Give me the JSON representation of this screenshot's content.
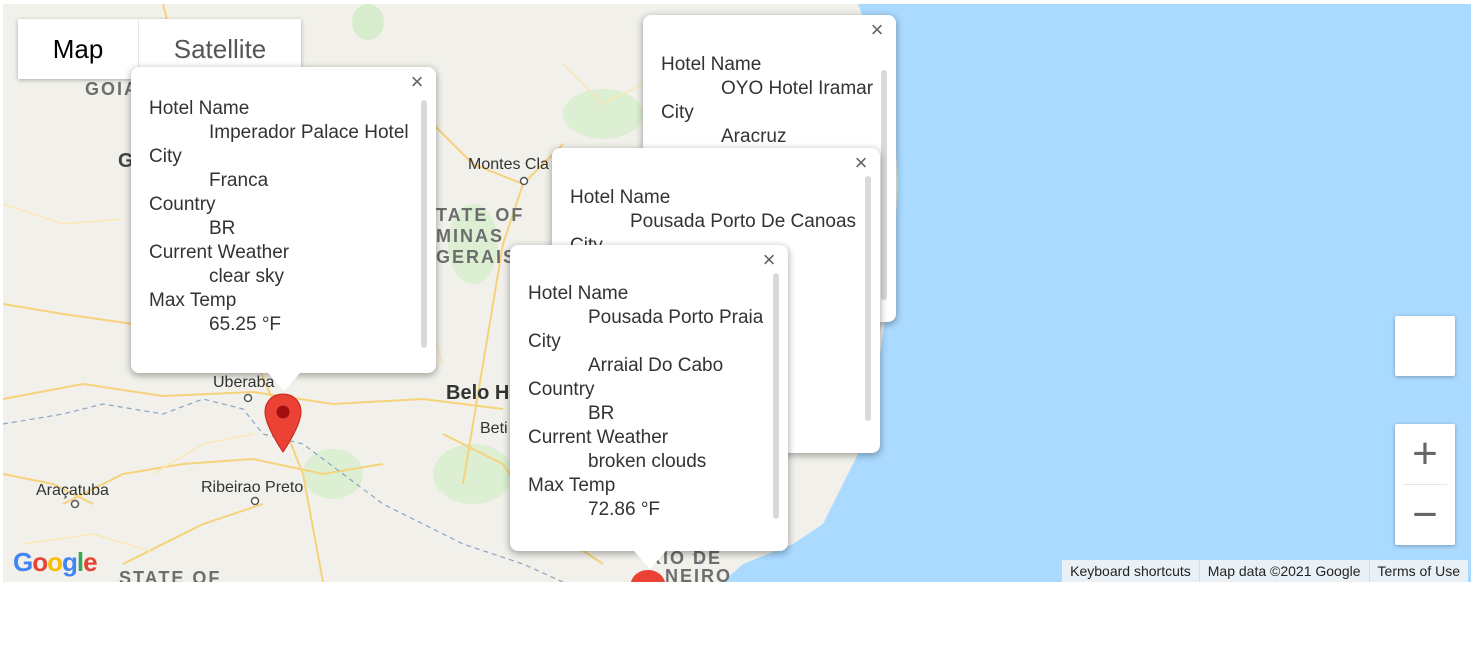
{
  "map_type": {
    "map_label": "Map",
    "satellite_label": "Satellite",
    "selected": "Map"
  },
  "place_labels": [
    {
      "id": "goias",
      "text": "GOIA"
    },
    {
      "id": "g",
      "text": "G"
    },
    {
      "id": "montes-claros",
      "text": "Montes Cla"
    },
    {
      "id": "state-of",
      "text": "TATE OF"
    },
    {
      "id": "minas",
      "text": "MINAS"
    },
    {
      "id": "gerais",
      "text": "GERAIS"
    },
    {
      "id": "uberaba",
      "text": "Uberaba"
    },
    {
      "id": "belo-horizonte",
      "text": "Belo H"
    },
    {
      "id": "betim",
      "text": "Beti"
    },
    {
      "id": "aracatuba",
      "text": "Araçatuba"
    },
    {
      "id": "ribeirao-preto",
      "text": "Ribeirao Preto"
    },
    {
      "id": "state-of-bottom",
      "text": "STATE OF"
    },
    {
      "id": "rio-de",
      "text": "RIO DE"
    },
    {
      "id": "janeiro",
      "text": "NEIRO"
    }
  ],
  "info_windows": [
    {
      "hotel_name_label": "Hotel Name",
      "hotel_name": "OYO Hotel Iramar",
      "city_label": "City",
      "city": "Aracruz"
    },
    {
      "hotel_name_label": "Hotel Name",
      "hotel_name": "Pousada Porto De Canoas",
      "city_label": "City"
    },
    {
      "hotel_name_label": "Hotel Name",
      "hotel_name": "Imperador Palace Hotel",
      "city_label": "City",
      "city": "Franca",
      "country_label": "Country",
      "country": "BR",
      "weather_label": "Current Weather",
      "weather": "clear sky",
      "temp_label": "Max Temp",
      "temp": "65.25 °F"
    },
    {
      "hotel_name_label": "Hotel Name",
      "hotel_name": "Pousada Porto Praia",
      "city_label": "City",
      "city": "Arraial Do Cabo",
      "country_label": "Country",
      "country": "BR",
      "weather_label": "Current Weather",
      "weather": "broken clouds",
      "temp_label": "Max Temp",
      "temp": "72.86 °F"
    }
  ],
  "close_glyph": "×",
  "zoom": {
    "in_glyph": "+",
    "out_glyph": "−"
  },
  "attribution": {
    "shortcuts": "Keyboard shortcuts",
    "map_data": "Map data ©2021 Google",
    "terms": "Terms of Use"
  },
  "logo": {
    "letters": [
      "G",
      "o",
      "o",
      "g",
      "l",
      "e"
    ],
    "colors": [
      "#4285F4",
      "#EA4335",
      "#FBBC05",
      "#4285F4",
      "#34A853",
      "#EA4335"
    ]
  },
  "colors": {
    "ocean": "#aadaff",
    "land": "#f1f0ea",
    "marker": "#ea4335",
    "road": "#f8d77a"
  }
}
